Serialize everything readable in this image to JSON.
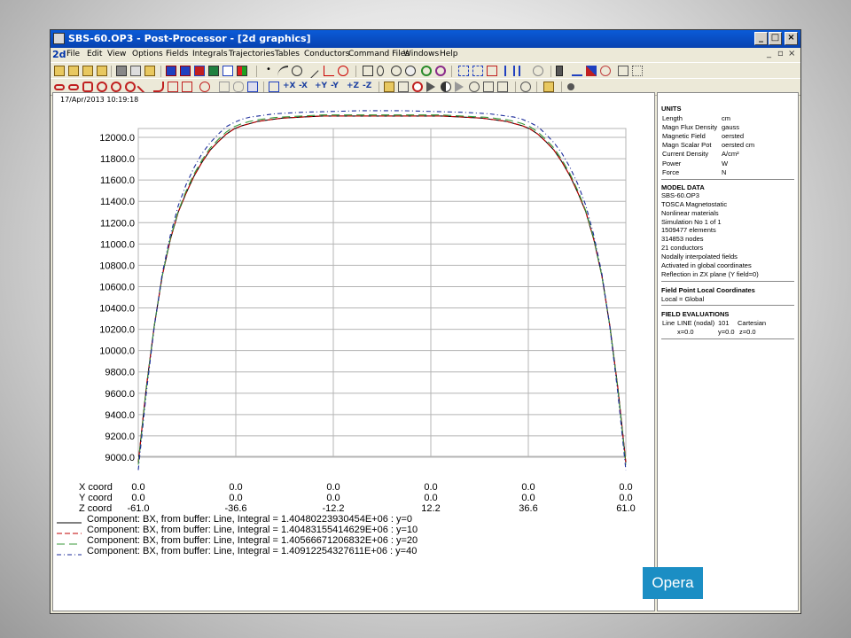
{
  "window": {
    "title": "SBS-60.OP3 - Post-Processor - [2d graphics]",
    "doc_icon": "2d",
    "controls": [
      "_",
      "□",
      "×"
    ],
    "mdi_controls": [
      "_",
      "×"
    ]
  },
  "menu": [
    "File",
    "Edit",
    "View",
    "Options",
    "Fields",
    "Integrals",
    "Trajectories",
    "Tables",
    "Conductors",
    "Command Files",
    "Windows",
    "Help"
  ],
  "toolbar2_text": [
    "+X",
    "-X",
    "+Y",
    "-Y",
    "+Z",
    "-Z"
  ],
  "timestamp": "17/Apr/2013 10:19:18",
  "axis_labels": {
    "x_coord": "X coord",
    "y_coord": "Y coord",
    "z_coord": "Z coord",
    "x_values": [
      "0.0",
      "0.0",
      "0.0",
      "0.0",
      "0.0",
      "0.0"
    ],
    "y_values": [
      "0.0",
      "0.0",
      "0.0",
      "0.0",
      "0.0",
      "0.0"
    ],
    "z_values": [
      "-61.0",
      "-36.6",
      "-12.2",
      "12.2",
      "36.6",
      "61.0"
    ]
  },
  "legend": [
    "Component: BX, from buffer: Line, Integral = 1.40480223930454E+06 : y=0",
    "Component: BX, from buffer: Line, Integral = 1.40483155414629E+06 : y=10",
    "Component: BX, from buffer: Line, Integral = 1.40566671206832E+06 : y=20",
    "Component: BX, from buffer: Line, Integral = 1.40912254327611E+06 : y=40"
  ],
  "chart_data": {
    "type": "line",
    "xlabel": "Z coord",
    "ylabel": "",
    "x_ticks": [
      -61.0,
      -36.6,
      -12.2,
      12.2,
      36.6,
      61.0
    ],
    "y_ticks": [
      "12000.0",
      "11800.0",
      "11600.0",
      "11400.0",
      "11200.0",
      "11000.0",
      "10800.0",
      "10600.0",
      "10400.0",
      "10200.0",
      "10000.0",
      "9800.0",
      "9600.0",
      "9400.0",
      "9200.0",
      "9000.0"
    ],
    "xlim": [
      -61.0,
      61.0
    ],
    "ylim": [
      8880,
      12000
    ],
    "grid": true,
    "series": [
      {
        "name": "Component: BX, from buffer: Line, Integral = 1.40480223930454E+06 : y=0",
        "style": "solid",
        "color": "#000000",
        "x": [
          -61,
          -59,
          -57,
          -55,
          -53,
          -51,
          -49,
          -47,
          -45,
          -43,
          -41,
          -39,
          -37,
          -35,
          -33,
          -31,
          -29,
          -27,
          -25,
          -20,
          -15,
          -10,
          -5,
          0,
          5,
          10,
          15,
          20,
          25,
          27,
          29,
          31,
          33,
          35,
          37,
          39,
          41,
          43,
          45,
          47,
          49,
          51,
          53,
          55,
          57,
          59,
          61
        ],
        "y": [
          8950,
          9650,
          10230,
          10700,
          11040,
          11300,
          11480,
          11640,
          11770,
          11880,
          11960,
          12030,
          12080,
          12110,
          12130,
          12150,
          12160,
          12170,
          12180,
          12190,
          12200,
          12200,
          12200,
          12200,
          12200,
          12200,
          12200,
          12190,
          12180,
          12170,
          12160,
          12150,
          12130,
          12110,
          12080,
          12030,
          11960,
          11880,
          11770,
          11640,
          11480,
          11300,
          11040,
          10700,
          10230,
          9650,
          8950
        ]
      },
      {
        "name": "Component: BX, from buffer: Line, Integral = 1.40483155414629E+06 : y=10",
        "style": "dash",
        "color": "#c00000",
        "x": [
          -61,
          -59,
          -57,
          -55,
          -53,
          -51,
          -49,
          -47,
          -45,
          -43,
          -41,
          -39,
          -37,
          -35,
          -33,
          -31,
          -29,
          -27,
          -25,
          -20,
          -15,
          -10,
          -5,
          0,
          5,
          10,
          15,
          20,
          25,
          27,
          29,
          31,
          33,
          35,
          37,
          39,
          41,
          43,
          45,
          47,
          49,
          51,
          53,
          55,
          57,
          59,
          61
        ],
        "y": [
          8950,
          9650,
          10230,
          10700,
          11040,
          11300,
          11480,
          11640,
          11770,
          11880,
          11960,
          12030,
          12080,
          12110,
          12130,
          12150,
          12160,
          12170,
          12180,
          12190,
          12200,
          12200,
          12200,
          12200,
          12200,
          12200,
          12200,
          12190,
          12180,
          12170,
          12160,
          12150,
          12130,
          12110,
          12080,
          12030,
          11960,
          11880,
          11770,
          11640,
          11480,
          11300,
          11040,
          10700,
          10230,
          9650,
          8950
        ]
      },
      {
        "name": "Component: BX, from buffer: Line, Integral = 1.40566671206832E+06 : y=20",
        "style": "longdash",
        "color": "#3a9a3a",
        "x": [
          -61,
          -59,
          -57,
          -55,
          -53,
          -51,
          -49,
          -47,
          -45,
          -43,
          -41,
          -39,
          -37,
          -35,
          -33,
          -31,
          -29,
          -27,
          -25,
          -20,
          -15,
          -10,
          -5,
          0,
          5,
          10,
          15,
          20,
          25,
          27,
          29,
          31,
          33,
          35,
          37,
          39,
          41,
          43,
          45,
          47,
          49,
          51,
          53,
          55,
          57,
          59,
          61
        ],
        "y": [
          8930,
          9640,
          10230,
          10700,
          11050,
          11310,
          11500,
          11660,
          11790,
          11900,
          11980,
          12050,
          12100,
          12130,
          12150,
          12165,
          12175,
          12185,
          12190,
          12200,
          12210,
          12210,
          12210,
          12210,
          12210,
          12210,
          12210,
          12200,
          12190,
          12185,
          12175,
          12165,
          12150,
          12130,
          12100,
          12050,
          11980,
          11900,
          11790,
          11660,
          11500,
          11310,
          11050,
          10700,
          10230,
          9640,
          8930
        ]
      },
      {
        "name": "Component: BX, from buffer: Line, Integral = 1.40912254327611E+06 : y=40",
        "style": "dashdot",
        "color": "#1a2a9a",
        "x": [
          -61,
          -59,
          -57,
          -55,
          -53,
          -51,
          -49,
          -47,
          -45,
          -43,
          -41,
          -39,
          -37,
          -35,
          -33,
          -31,
          -29,
          -27,
          -25,
          -20,
          -15,
          -10,
          -5,
          0,
          5,
          10,
          15,
          20,
          25,
          27,
          29,
          31,
          33,
          35,
          37,
          39,
          41,
          43,
          45,
          47,
          49,
          51,
          53,
          55,
          57,
          59,
          61
        ],
        "y": [
          8880,
          9600,
          10220,
          10720,
          11080,
          11360,
          11560,
          11720,
          11850,
          11950,
          12030,
          12100,
          12140,
          12170,
          12190,
          12200,
          12210,
          12220,
          12225,
          12235,
          12240,
          12245,
          12250,
          12250,
          12250,
          12245,
          12240,
          12235,
          12225,
          12220,
          12210,
          12200,
          12190,
          12170,
          12140,
          12100,
          12030,
          11950,
          11850,
          11720,
          11560,
          11360,
          11080,
          10720,
          10220,
          9600,
          8880
        ]
      }
    ]
  },
  "sidepanel": {
    "units_title": "UNITS",
    "units": [
      [
        "Length",
        "cm"
      ],
      [
        "Magn Flux Density",
        "gauss"
      ],
      [
        "Magnetic Field",
        "oersted"
      ],
      [
        "Magn Scalar Pot",
        "oersted cm"
      ],
      [
        "Current Density",
        "A/cm²"
      ],
      [
        "Power",
        "W"
      ],
      [
        "Force",
        "N"
      ]
    ],
    "model_title": "MODEL DATA",
    "model": [
      "SBS-60.OP3",
      "TOSCA Magnetostatic",
      "Nonlinear materials",
      "Simulation No 1 of 1",
      "1509477 elements",
      "314853 nodes",
      "21 conductors",
      "Nodally interpolated fields",
      "Activated in global coordinates",
      "Reflection in ZX plane (Y field=0)"
    ],
    "fp_title": "Field Point Local Coordinates",
    "fp_value": "Local = Global",
    "eval_title": "FIELD EVALUATIONS",
    "eval_line1": [
      "Line",
      "LINE (nodal)",
      "101",
      "Cartesian"
    ],
    "eval_line2": [
      "x=0.0",
      "y=0.0",
      "z=0.0"
    ]
  },
  "logo": "Opera",
  "colors": {
    "title_bar": "#0a4fc8",
    "logo_bg": "#1b8ec4",
    "grid": "#b4b4b4"
  }
}
